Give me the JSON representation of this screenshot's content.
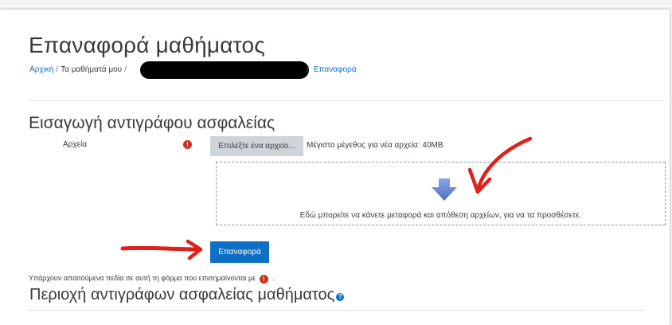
{
  "page": {
    "title": "Επαναφορά μαθήματος"
  },
  "breadcrumb": {
    "home": "Αρχική",
    "separator": "/",
    "my_courses": "Τα μαθήματά μου",
    "current": "Επαναφορά"
  },
  "import_section": {
    "title": "Εισαγωγή αντιγράφου ασφαλείας",
    "files_label": "Αρχεία",
    "required_icon_glyph": "!",
    "choose_button": "Επιλέξτε ένα αρχείο...",
    "max_size": "Μέγιστο μέγεθος για νέα αρχεία: 40MB",
    "dropzone_text": "Εδώ μπορείτε να κάνετε μεταφορά και απόθεση αρχείων, για να τα προσθέσετε.",
    "submit_button": "Επαναφορά"
  },
  "required_note": {
    "text": "Υπάρχουν απαιτούμενα πεδία σε αυτή τη φόρμα που επισημαίνονται με",
    "suffix": "."
  },
  "backup_area": {
    "title": "Περιοχή αντιγράφων ασφαλείας μαθήματος",
    "help_icon_glyph": "?"
  },
  "colors": {
    "link": "#0f6fc5",
    "primary_button": "#0f6fc5",
    "required": "#ca3120",
    "annotation": "#e0201b",
    "drop_arrow": "#6f8fd6"
  },
  "icons": {
    "required": "exclamation-circle-icon",
    "help": "question-circle-icon",
    "dropzone": "down-arrow-icon"
  }
}
